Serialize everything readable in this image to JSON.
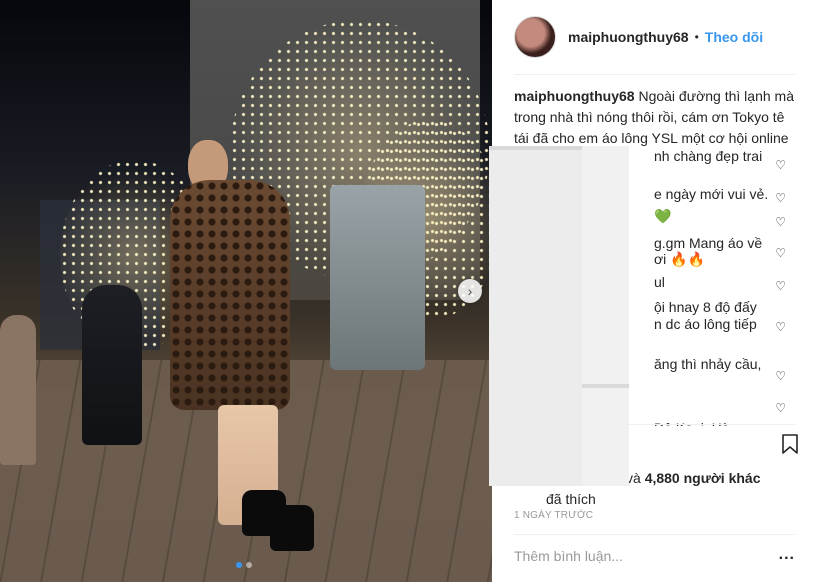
{
  "post": {
    "username": "maiphuongthuy68",
    "separator": "•",
    "follow_label": "Theo dõi",
    "caption_user": "maiphuongthuy68",
    "caption_text_1": "Ngoài đường thì lạnh mà",
    "caption_text_2": "trong nhà thì nóng thôi rồi, cám ơn Tokyo tê",
    "caption_text_3": "tái đã cho em áo lông YSL một cơ hội online",
    "comments": [
      "nh chàng đẹp trai",
      "e ngày mới vui vẻ.",
      "💚",
      "g.gm  Mang áo về",
      "ơi 🔥🔥",
      "ul",
      "ội hnay 8 độ đấy",
      "n dc áo lông tiếp",
      "ăng thì nhảy cầu,",
      "Đô Ka..i..Hà"
    ],
    "likes_prefix": "và",
    "likes_count": "4,880 người khác",
    "likes_suffix": "đã thích",
    "timestamp": "1 NGÀY TRƯỚC",
    "add_comment_placeholder": "Thêm bình luận...",
    "more_label": "...",
    "next_label": "›"
  },
  "colors": {
    "accent": "#3897f0",
    "text": "#262626",
    "muted": "#999999",
    "divider": "#efefef"
  },
  "icons": {
    "heart": "heart-outline-icon",
    "bookmark": "bookmark-icon",
    "next": "chevron-right-icon"
  }
}
